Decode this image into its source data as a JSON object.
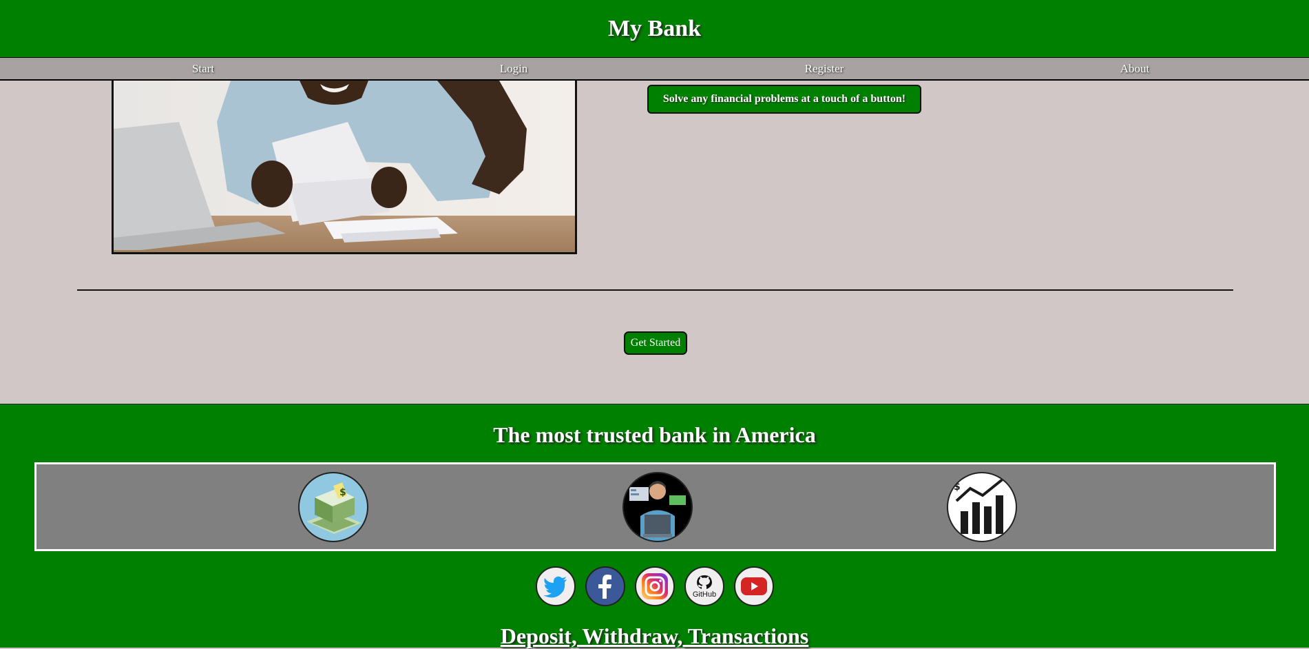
{
  "header": {
    "title": "My Bank"
  },
  "nav": {
    "items": [
      "Start",
      "Login",
      "Register",
      "About"
    ]
  },
  "hero": {
    "image_icon": "man-reading-letter-photo",
    "tagline": "Solve any financial problems at a touch of a button!"
  },
  "cta": {
    "label": "Get Started"
  },
  "footer": {
    "title": "The most trusted bank in America",
    "features": [
      {
        "icon": "money-stack-icon"
      },
      {
        "icon": "banker-at-laptop-icon"
      },
      {
        "icon": "growth-chart-icon"
      }
    ],
    "socials": [
      {
        "icon": "twitter-icon"
      },
      {
        "icon": "facebook-icon"
      },
      {
        "icon": "instagram-icon"
      },
      {
        "icon": "github-icon",
        "text": "GitHub"
      },
      {
        "icon": "youtube-icon"
      }
    ],
    "subtitle": "Deposit, Withdraw, Transactions"
  },
  "colors": {
    "brand_green": "#008000",
    "page_bg": "#d1c7c6",
    "nav_bg": "#a8a3a2",
    "feature_bg": "#808080"
  }
}
